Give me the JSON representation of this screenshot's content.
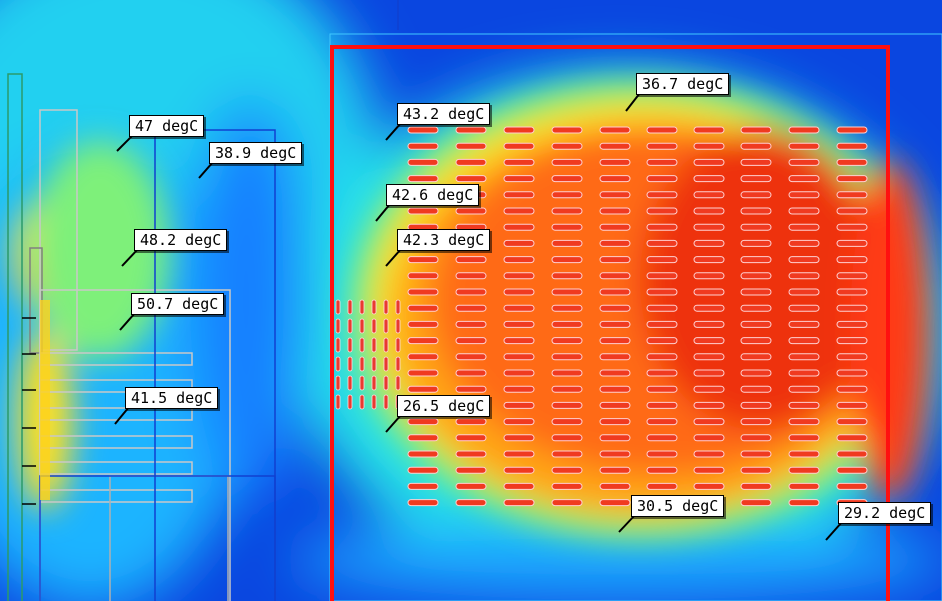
{
  "probes": [
    {
      "label": "47 degC",
      "value": 47
    },
    {
      "label": "38.9 degC",
      "value": 38.9
    },
    {
      "label": "48.2 degC",
      "value": 48.2
    },
    {
      "label": "50.7 degC",
      "value": 50.7
    },
    {
      "label": "41.5 degC",
      "value": 41.5
    },
    {
      "label": "36.7 degC",
      "value": 36.7
    },
    {
      "label": "43.2 degC",
      "value": 43.2
    },
    {
      "label": "42.6 degC",
      "value": 42.6
    },
    {
      "label": "42.3 degC",
      "value": 42.3
    },
    {
      "label": "26.5 degC",
      "value": 26.5
    },
    {
      "label": "30.5 degC",
      "value": 30.5
    },
    {
      "label": "29.2 degC",
      "value": 29.2
    }
  ],
  "colors": {
    "cold": "#0a46e0",
    "cool": "#1fb4ff",
    "cyan": "#24e6e6",
    "warm": "#ffd21a",
    "hot": "#ff5a10",
    "hottest": "#e81f10",
    "boundary": "#ff1010",
    "outline_blue": "#1040d0",
    "outline_gray": "#c8c8c8"
  }
}
